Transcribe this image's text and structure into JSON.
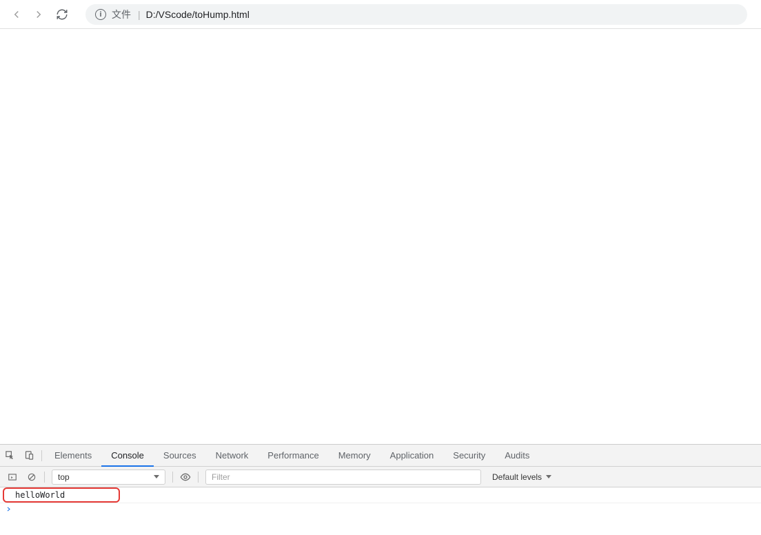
{
  "browser": {
    "address_scheme": "文件",
    "address_url": "D:/VScode/toHump.html",
    "address_separator": "|",
    "info_glyph": "i"
  },
  "devtools": {
    "tabs": {
      "elements": "Elements",
      "console": "Console",
      "sources": "Sources",
      "network": "Network",
      "performance": "Performance",
      "memory": "Memory",
      "application": "Application",
      "security": "Security",
      "audits": "Audits"
    },
    "active_tab": "console"
  },
  "console_toolbar": {
    "context_label": "top",
    "filter_placeholder": "Filter",
    "levels_label": "Default levels"
  },
  "console": {
    "rows": [
      {
        "text": "helloWorld"
      }
    ]
  }
}
